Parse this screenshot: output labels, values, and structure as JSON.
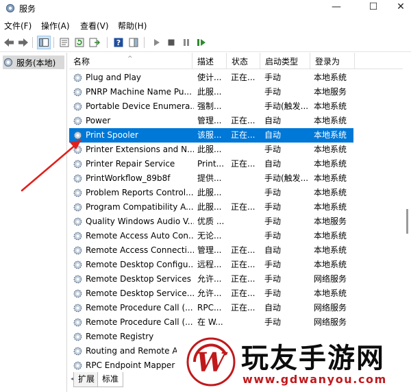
{
  "window": {
    "title": "服务",
    "icon": "gear-icon"
  },
  "window_controls": {
    "minimize": "—",
    "maximize": "☐",
    "close": "✕"
  },
  "menu": [
    "文件(F)",
    "操作(A)",
    "查看(V)",
    "帮助(H)"
  ],
  "toolbar_icons": [
    "back-arrow-icon",
    "forward-arrow-icon",
    "show-hide-tree-icon",
    "properties-icon",
    "refresh-icon",
    "export-list-icon",
    "help-icon",
    "action-pane-icon",
    "start-service-icon",
    "stop-service-icon",
    "pause-service-icon",
    "resume-service-icon"
  ],
  "tree": {
    "selected_item": "服务(本地)"
  },
  "columns": [
    "名称",
    "描述",
    "状态",
    "启动类型",
    "登录为"
  ],
  "services": [
    {
      "name": "Plug and Play",
      "desc": "使计...",
      "status": "正在...",
      "startup": "手动",
      "logon": "本地系统"
    },
    {
      "name": "PNRP Machine Name Pu...",
      "desc": "此服...",
      "status": "",
      "startup": "手动",
      "logon": "本地服务"
    },
    {
      "name": "Portable Device Enumera...",
      "desc": "强制...",
      "status": "",
      "startup": "手动(触发...",
      "logon": "本地系统"
    },
    {
      "name": "Power",
      "desc": "管理...",
      "status": "正在...",
      "startup": "自动",
      "logon": "本地系统"
    },
    {
      "name": "Print Spooler",
      "desc": "该服...",
      "status": "正在...",
      "startup": "自动",
      "logon": "本地系统"
    },
    {
      "name": "Printer Extensions and N...",
      "desc": "此服...",
      "status": "",
      "startup": "手动",
      "logon": "本地系统"
    },
    {
      "name": "Printer Repair Service",
      "desc": "Print...",
      "status": "正在...",
      "startup": "自动",
      "logon": "本地系统"
    },
    {
      "name": "PrintWorkflow_89b8f",
      "desc": "提供...",
      "status": "",
      "startup": "手动(触发...",
      "logon": "本地系统"
    },
    {
      "name": "Problem Reports Control...",
      "desc": "此服...",
      "status": "",
      "startup": "手动",
      "logon": "本地系统"
    },
    {
      "name": "Program Compatibility A...",
      "desc": "此服...",
      "status": "正在...",
      "startup": "手动",
      "logon": "本地系统"
    },
    {
      "name": "Quality Windows Audio V...",
      "desc": "优质 ...",
      "status": "",
      "startup": "手动",
      "logon": "本地服务"
    },
    {
      "name": "Remote Access Auto Con...",
      "desc": "无论...",
      "status": "",
      "startup": "手动",
      "logon": "本地系统"
    },
    {
      "name": "Remote Access Connecti...",
      "desc": "管理...",
      "status": "正在...",
      "startup": "自动",
      "logon": "本地系统"
    },
    {
      "name": "Remote Desktop Configu...",
      "desc": "远程...",
      "status": "正在...",
      "startup": "手动",
      "logon": "本地系统"
    },
    {
      "name": "Remote Desktop Services",
      "desc": "允许...",
      "status": "正在...",
      "startup": "手动",
      "logon": "网络服务"
    },
    {
      "name": "Remote Desktop Service...",
      "desc": "允许...",
      "status": "正在...",
      "startup": "手动",
      "logon": "本地系统"
    },
    {
      "name": "Remote Procedure Call (...",
      "desc": "RPC...",
      "status": "正在...",
      "startup": "自动",
      "logon": "网络服务"
    },
    {
      "name": "Remote Procedure Call (...",
      "desc": "在 W...",
      "status": "",
      "startup": "手动",
      "logon": "网络服务"
    },
    {
      "name": "Remote Registry",
      "desc": "",
      "status": "",
      "startup": "",
      "logon": ""
    },
    {
      "name": "Routing and Remote A",
      "desc": "",
      "status": "",
      "startup": "",
      "logon": ""
    },
    {
      "name": "RPC Endpoint Mapper",
      "desc": "",
      "status": "",
      "startup": "",
      "logon": ""
    }
  ],
  "selected_row": "Print Spooler",
  "tabs": [
    "扩展",
    "标准"
  ],
  "active_tab": "标准",
  "annotation": {
    "color": "#e0201c"
  },
  "watermark_overlay": {
    "title": "玩友手游网",
    "url": "www.gdwanyou.com",
    "logo_color": "#c0191c"
  },
  "colors": {
    "selection": "#0078d7",
    "title_bg": "#ffffff"
  }
}
